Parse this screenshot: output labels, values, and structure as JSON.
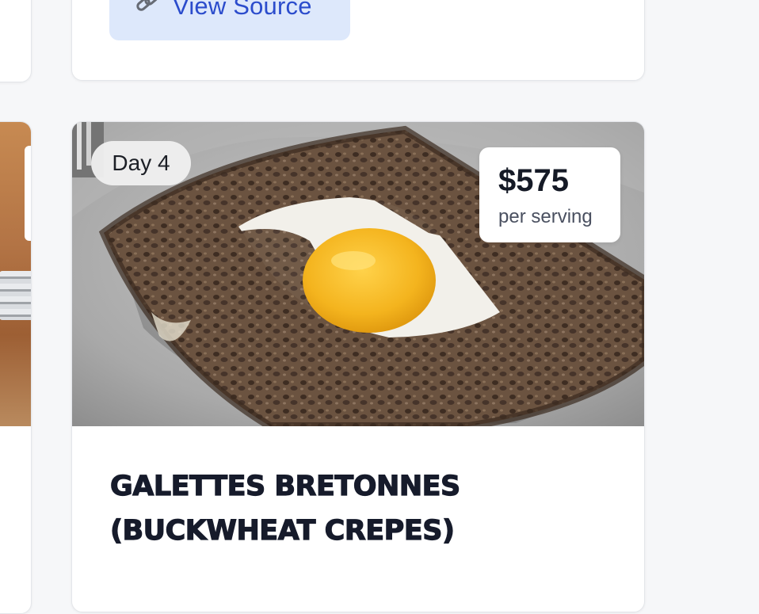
{
  "top_card": {
    "view_source_label": "View Source",
    "link_icon": "link-icon"
  },
  "recipe_card": {
    "day_label": "Day 4",
    "price": "$575",
    "price_unit": "per serving",
    "title_line1": "GALETTES BRETONNES",
    "title_line2": "(BUCKWHEAT CREPES)",
    "image_alt": "buckwheat-crepe-with-egg-photo"
  },
  "colors": {
    "page_background": "#f6f7f9",
    "button_background": "#dde8fb",
    "button_text": "#2b4ccc",
    "title_text": "#161b2b"
  }
}
